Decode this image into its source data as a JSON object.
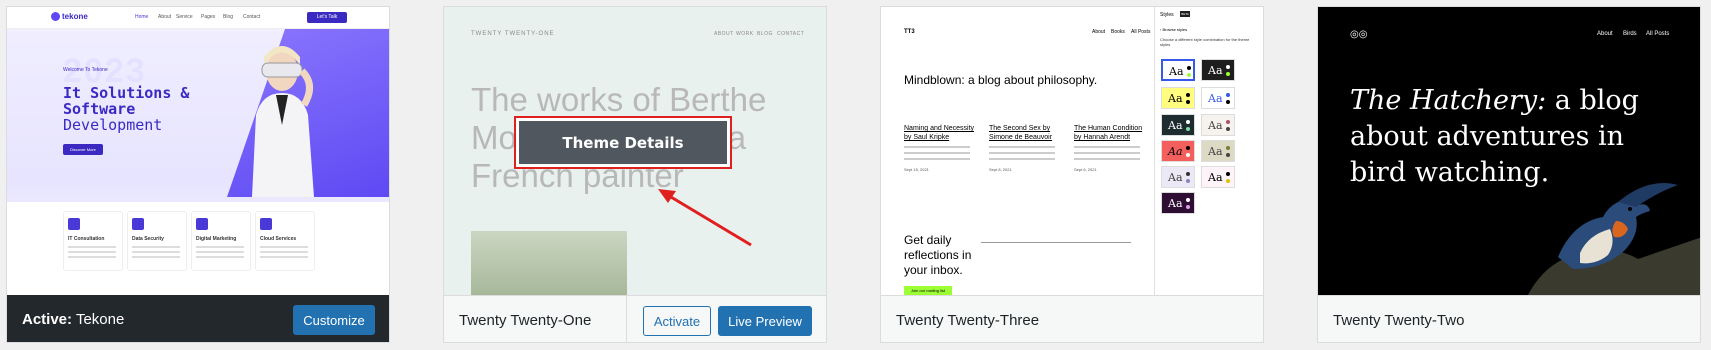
{
  "themes": [
    {
      "id": "tekone",
      "active_prefix": "Active:",
      "name": "Tekone",
      "action": "Customize",
      "preview": {
        "logo": "tekone",
        "nav": [
          "Home",
          "About",
          "Service",
          "Pages",
          "Blog",
          "Contact"
        ],
        "nav_cta": "Let's Talk",
        "welcome": "Welcome To Tekone",
        "year": "2023",
        "headline": [
          "It Solutions &",
          "Software",
          "Development"
        ],
        "cta": "Discover More",
        "services": [
          "IT Consultation",
          "Data Security",
          "Digital Marketing",
          "Cloud Services"
        ]
      }
    },
    {
      "id": "twentytwentyone",
      "name": "Twenty Twenty-One",
      "actions": [
        "Activate",
        "Live Preview"
      ],
      "overlay": "Theme Details",
      "preview": {
        "site_title": "TWENTY TWENTY-ONE",
        "nav": [
          "ABOUT",
          "WORK",
          "BLOG",
          "CONTACT"
        ],
        "headline": "The works of Berthe Morisot, 1800s-era French painter"
      }
    },
    {
      "id": "twentytwentythree",
      "name": "Twenty Twenty-Three",
      "preview": {
        "site_title": "TT3",
        "nav": [
          "About",
          "Books",
          "All Posts"
        ],
        "headline": "Mindblown: a blog about philosophy.",
        "posts": [
          {
            "title": "Naming and Necessity by Saul Kripke",
            "date": "Sept 15, 2021"
          },
          {
            "title": "The Second Sex by Simone de Beauvoir",
            "date": "Sept 8, 2021"
          },
          {
            "title": "The Human Condition by Hannah Arendt",
            "date": "Sept 6, 2021"
          }
        ],
        "newsletter": "Get daily reflections in your inbox.",
        "join": "Join our mailing list",
        "panel_title": "Styles",
        "panel_badge": "BETA",
        "panel_back": "Browse styles",
        "panel_desc": "Choose a different style combination for the theme styles",
        "swatch_label": "Aa"
      }
    },
    {
      "id": "twentytwentytwo",
      "name": "Twenty Twenty-Two",
      "preview": {
        "nav": [
          "About",
          "Birds",
          "All Posts"
        ],
        "headline_italic": "The Hatchery:",
        "headline_rest": " a blog about adventures in bird watching."
      }
    }
  ],
  "colors": {
    "wp_blue": "#2271b1",
    "active_bar": "#23282d",
    "highlight_red": "#e01f1f"
  }
}
